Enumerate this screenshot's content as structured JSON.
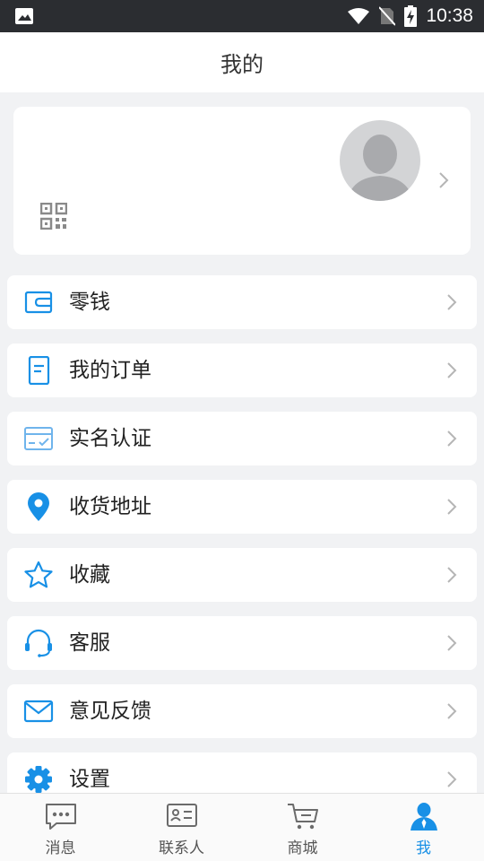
{
  "status_bar": {
    "time": "10:38"
  },
  "header": {
    "title": "我的"
  },
  "menu": [
    {
      "label": "零钱",
      "icon": "wallet-icon"
    },
    {
      "label": "我的订单",
      "icon": "order-icon"
    },
    {
      "label": "实名认证",
      "icon": "id-card-icon"
    },
    {
      "label": "收货地址",
      "icon": "location-pin-icon"
    },
    {
      "label": "收藏",
      "icon": "star-icon"
    },
    {
      "label": "客服",
      "icon": "headset-icon"
    },
    {
      "label": "意见反馈",
      "icon": "mail-icon"
    },
    {
      "label": "设置",
      "icon": "gear-icon"
    }
  ],
  "tabs": [
    {
      "label": "消息",
      "icon": "message-icon",
      "active": false
    },
    {
      "label": "联系人",
      "icon": "contacts-icon",
      "active": false
    },
    {
      "label": "商城",
      "icon": "cart-icon",
      "active": false
    },
    {
      "label": "我",
      "icon": "person-icon",
      "active": true
    }
  ],
  "colors": {
    "accent": "#1890e6",
    "background": "#f1f2f4",
    "status_bar": "#2b2d31"
  }
}
